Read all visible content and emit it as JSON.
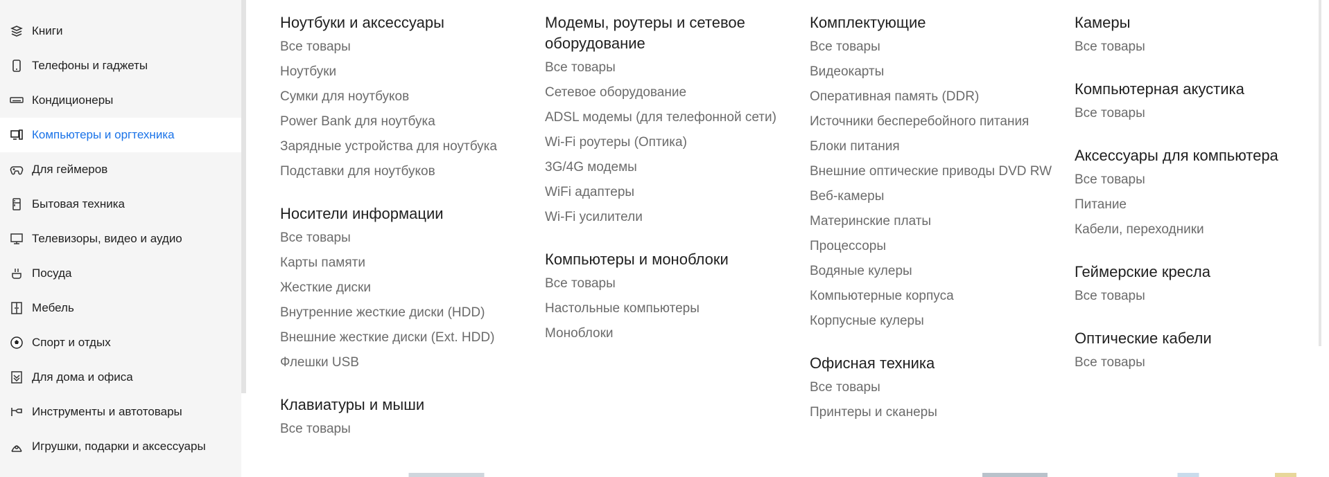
{
  "sidebar": {
    "items": [
      {
        "label": "Книги",
        "icon": "books-icon"
      },
      {
        "label": "Телефоны и гаджеты",
        "icon": "phone-icon"
      },
      {
        "label": "Кондиционеры",
        "icon": "air-conditioner-icon"
      },
      {
        "label": "Компьютеры и оргтехника",
        "icon": "computer-icon",
        "active": true
      },
      {
        "label": "Для геймеров",
        "icon": "gamepad-icon"
      },
      {
        "label": "Бытовая техника",
        "icon": "fridge-icon"
      },
      {
        "label": "Телевизоры, видео и аудио",
        "icon": "tv-icon"
      },
      {
        "label": "Посуда",
        "icon": "dishes-icon"
      },
      {
        "label": "Мебель",
        "icon": "furniture-icon"
      },
      {
        "label": "Спорт и отдых",
        "icon": "ball-icon"
      },
      {
        "label": "Для дома и офиса",
        "icon": "home-office-icon"
      },
      {
        "label": "Инструменты и автотовары",
        "icon": "tools-icon"
      },
      {
        "label": "Игрушки, подарки и аксессуары",
        "icon": "gift-icon"
      }
    ],
    "active_color": "#1a73e8"
  },
  "menu": {
    "col1": [
      {
        "title": "Ноутбуки и аксессуары",
        "links": [
          "Все товары",
          "Ноутбуки",
          "Сумки для ноутбуков",
          "Power Bank для ноутбука",
          "Зарядные устройства для ноутбука",
          "Подставки для ноутбуков"
        ]
      },
      {
        "title": "Носители информации",
        "links": [
          "Все товары",
          "Карты памяти",
          "Жесткие диски",
          "Внутренние жесткие диски (HDD)",
          "Внешние жесткие диски (Ext. HDD)",
          "Флешки USB"
        ]
      },
      {
        "title": "Клавиатуры и мыши",
        "links": [
          "Все товары"
        ]
      }
    ],
    "col2": [
      {
        "title": "Модемы, роутеры и сетевое оборудование",
        "links": [
          "Все товары",
          "Сетевое оборудование",
          "ADSL модемы (для телефонной сети)",
          "Wi-Fi роутеры (Оптика)",
          "3G/4G модемы",
          "WiFi адаптеры",
          "Wi-Fi усилители"
        ]
      },
      {
        "title": "Компьютеры и моноблоки",
        "links": [
          "Все товары",
          "Настольные компьютеры",
          "Моноблоки"
        ]
      }
    ],
    "col3": [
      {
        "title": "Комплектующие",
        "links": [
          "Все товары",
          "Видеокарты",
          "Оперативная память (DDR)",
          "Источники бесперебойного питания",
          "Блоки питания",
          "Внешние оптические приводы DVD RW",
          "Веб-камеры",
          "Материнские платы",
          "Процессоры",
          "Водяные кулеры",
          "Компьютерные корпуса",
          "Корпусные кулеры"
        ]
      },
      {
        "title": "Офисная техника",
        "links": [
          "Все товары",
          "Принтеры и сканеры"
        ]
      }
    ],
    "col4": [
      {
        "title": "Камеры",
        "links": [
          "Все товары"
        ]
      },
      {
        "title": "Компьютерная акустика",
        "links": [
          "Все товары"
        ]
      },
      {
        "title": "Аксессуары для компьютера",
        "links": [
          "Все товары",
          "Питание",
          "Кабели, переходники"
        ]
      },
      {
        "title": "Геймерские кресла",
        "links": [
          "Все товары"
        ]
      },
      {
        "title": "Оптические кабели",
        "links": [
          "Все товары"
        ]
      }
    ]
  }
}
